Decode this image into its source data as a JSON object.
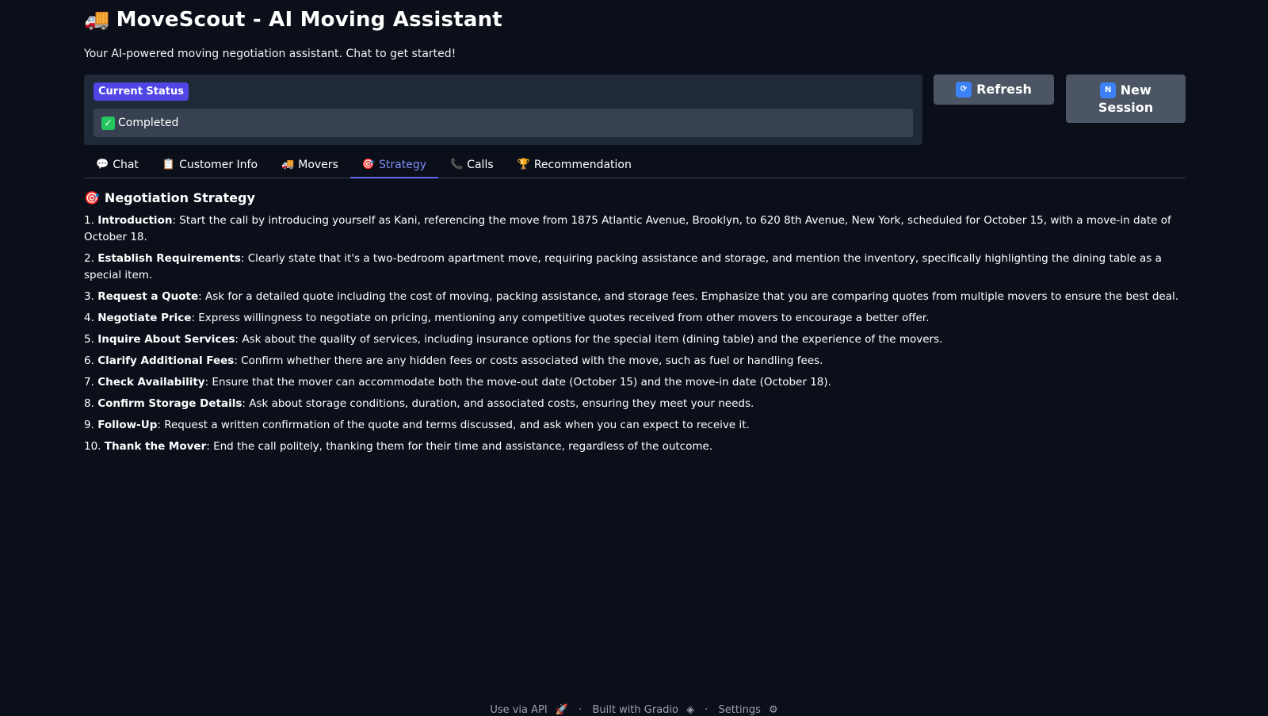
{
  "header": {
    "title": "MoveScout - AI Moving Assistant",
    "title_icon": "truck-icon",
    "subtitle": "Your AI-powered moving negotiation assistant. Chat to get started!"
  },
  "status": {
    "label": "Current Status",
    "value": "Completed",
    "icon": "check-icon"
  },
  "buttons": {
    "refresh": "Refresh",
    "new_session": "New Session"
  },
  "tabs": [
    {
      "label": "Chat",
      "icon": "speech-bubble-icon"
    },
    {
      "label": "Customer Info",
      "icon": "clipboard-icon"
    },
    {
      "label": "Movers",
      "icon": "truck-icon"
    },
    {
      "label": "Strategy",
      "icon": "target-icon",
      "active": true
    },
    {
      "label": "Calls",
      "icon": "phone-icon"
    },
    {
      "label": "Recommendation",
      "icon": "trophy-icon"
    }
  ],
  "strategy": {
    "title": "Negotiation Strategy",
    "steps": [
      {
        "num": "1.",
        "title": "Introduction",
        "text": ": Start the call by introducing yourself as Kani, referencing the move from 1875 Atlantic Avenue, Brooklyn, to 620 8th Avenue, New York, scheduled for October 15, with a move-in date of October 18."
      },
      {
        "num": "2.",
        "title": "Establish Requirements",
        "text": ": Clearly state that it's a two-bedroom apartment move, requiring packing assistance and storage, and mention the inventory, specifically highlighting the dining table as a special item."
      },
      {
        "num": "3.",
        "title": "Request a Quote",
        "text": ": Ask for a detailed quote including the cost of moving, packing assistance, and storage fees. Emphasize that you are comparing quotes from multiple movers to ensure the best deal."
      },
      {
        "num": "4.",
        "title": "Negotiate Price",
        "text": ": Express willingness to negotiate on pricing, mentioning any competitive quotes received from other movers to encourage a better offer."
      },
      {
        "num": "5.",
        "title": "Inquire About Services",
        "text": ": Ask about the quality of services, including insurance options for the special item (dining table) and the experience of the movers."
      },
      {
        "num": "6.",
        "title": "Clarify Additional Fees",
        "text": ": Confirm whether there are any hidden fees or costs associated with the move, such as fuel or handling fees."
      },
      {
        "num": "7.",
        "title": "Check Availability",
        "text": ": Ensure that the mover can accommodate both the move-out date (October 15) and the move-in date (October 18)."
      },
      {
        "num": "8.",
        "title": "Confirm Storage Details",
        "text": ": Ask about storage conditions, duration, and associated costs, ensuring they meet your needs."
      },
      {
        "num": "9.",
        "title": "Follow-Up",
        "text": ": Request a written confirmation of the quote and terms discussed, and ask when you can expect to receive it."
      },
      {
        "num": "10.",
        "title": "Thank the Mover",
        "text": ": End the call politely, thanking them for their time and assistance, regardless of the outcome."
      }
    ]
  },
  "footer": {
    "api": "Use via API",
    "sep1": "·",
    "built": "Built with Gradio",
    "sep2": "·",
    "settings": "Settings"
  },
  "colors": {
    "background": "#0b0f19",
    "accent": "#6366f1",
    "status_label": "#4f46e5",
    "panel": "#1f2937",
    "button": "#4b5563"
  }
}
